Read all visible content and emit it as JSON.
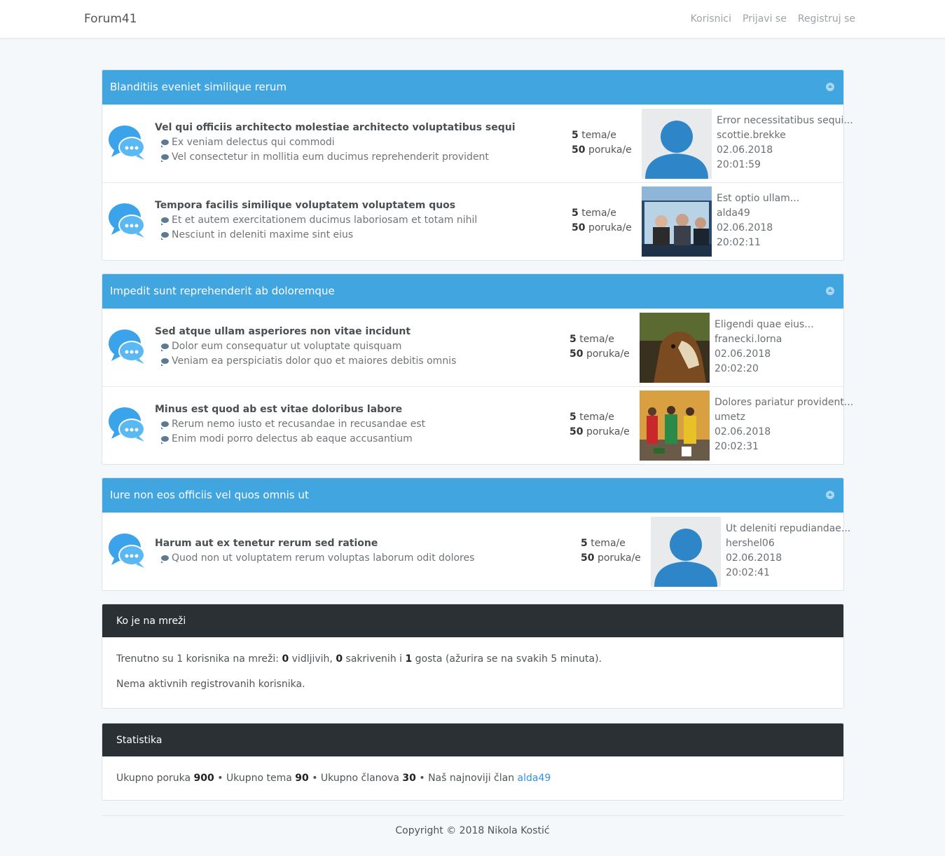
{
  "nav": {
    "brand": "Forum41",
    "links": [
      "Korisnici",
      "Prijavi se",
      "Registruj se"
    ]
  },
  "categories": [
    {
      "title": "Blanditiis eveniet similique rerum",
      "forums": [
        {
          "title": "Vel qui officiis architecto molestiae architecto voluptatibus sequi",
          "subs": [
            "Ex veniam delectus qui commodi",
            "Vel consectetur in mollitia eum ducimus reprehenderit provident"
          ],
          "topics": "5",
          "topics_label": "tema/e",
          "posts": "50",
          "posts_label": "poruka/e",
          "last": {
            "title": "Error necessitatibus sequi...",
            "user": "scottie.brekke",
            "date": "02.06.2018",
            "time": "20:01:59",
            "image": "default-avatar"
          }
        },
        {
          "title": "Tempora facilis similique voluptatem voluptatem quos",
          "subs": [
            "Et et autem exercitationem ducimus laboriosam et totam nihil",
            "Nesciunt in deleniti maxime sint eius"
          ],
          "topics": "5",
          "topics_label": "tema/e",
          "posts": "50",
          "posts_label": "poruka/e",
          "last": {
            "title": "Est optio ullam...",
            "user": "alda49",
            "date": "02.06.2018",
            "time": "20:02:11",
            "image": "photo-people-on-bus"
          }
        }
      ]
    },
    {
      "title": "Impedit sunt reprehenderit ab doloremque",
      "forums": [
        {
          "title": "Sed atque ullam asperiores non vitae incidunt",
          "subs": [
            "Dolor eum consequatur ut voluptate quisquam",
            "Veniam ea perspiciatis dolor quo et maiores debitis omnis"
          ],
          "topics": "5",
          "topics_label": "tema/e",
          "posts": "50",
          "posts_label": "poruka/e",
          "last": {
            "title": "Eligendi quae eius...",
            "user": "franecki.lorna",
            "date": "02.06.2018",
            "time": "20:02:20",
            "image": "photo-horse"
          }
        },
        {
          "title": "Minus est quod ab est vitae doloribus labore",
          "subs": [
            "Rerum nemo iusto et recusandae in recusandae est",
            "Enim modi porro delectus ab eaque accusantium"
          ],
          "topics": "5",
          "topics_label": "tema/e",
          "posts": "50",
          "posts_label": "poruka/e",
          "last": {
            "title": "Dolores pariatur provident...",
            "user": "umetz",
            "date": "02.06.2018",
            "time": "20:02:31",
            "image": "photo-women-colorful-dresses"
          }
        }
      ]
    },
    {
      "title": "Iure non eos officiis vel quos omnis ut",
      "forums": [
        {
          "title": "Harum aut ex tenetur rerum sed ratione",
          "subs": [
            "Quod non ut voluptatem rerum voluptas laborum odit dolores"
          ],
          "topics": "5",
          "topics_label": "tema/e",
          "posts": "50",
          "posts_label": "poruka/e",
          "last": {
            "title": "Ut deleniti repudiandae...",
            "user": "hershel06",
            "date": "02.06.2018",
            "time": "20:02:41",
            "image": "default-avatar"
          }
        }
      ]
    }
  ],
  "online": {
    "title": "Ko je na mreži",
    "line1_a": "Trenutno su 1 korisnika na mreži: ",
    "visible": "0",
    "line1_b": " vidljivih, ",
    "hidden": "0",
    "line1_c": " sakrivenih i ",
    "guests": "1",
    "line1_d": " gosta (ažurira se na svakih 5 minuta).",
    "line2": "Nema aktivnih registrovanih korisnika."
  },
  "stats": {
    "title": "Statistika",
    "posts_label": "Ukupno poruka ",
    "posts": "900",
    "topics_label": " • Ukupno tema ",
    "topics": "90",
    "members_label": " • Ukupno članova ",
    "members": "30",
    "newest_label": " • Naš najnoviji član ",
    "newest": "alda49"
  },
  "footer": "Copyright © 2018 Nikola Kostić",
  "colors": {
    "header_blue": "#41a6e0",
    "panel_dark": "#2b3035",
    "link": "#3490dc",
    "avatar_blue": "#2e86c8"
  }
}
